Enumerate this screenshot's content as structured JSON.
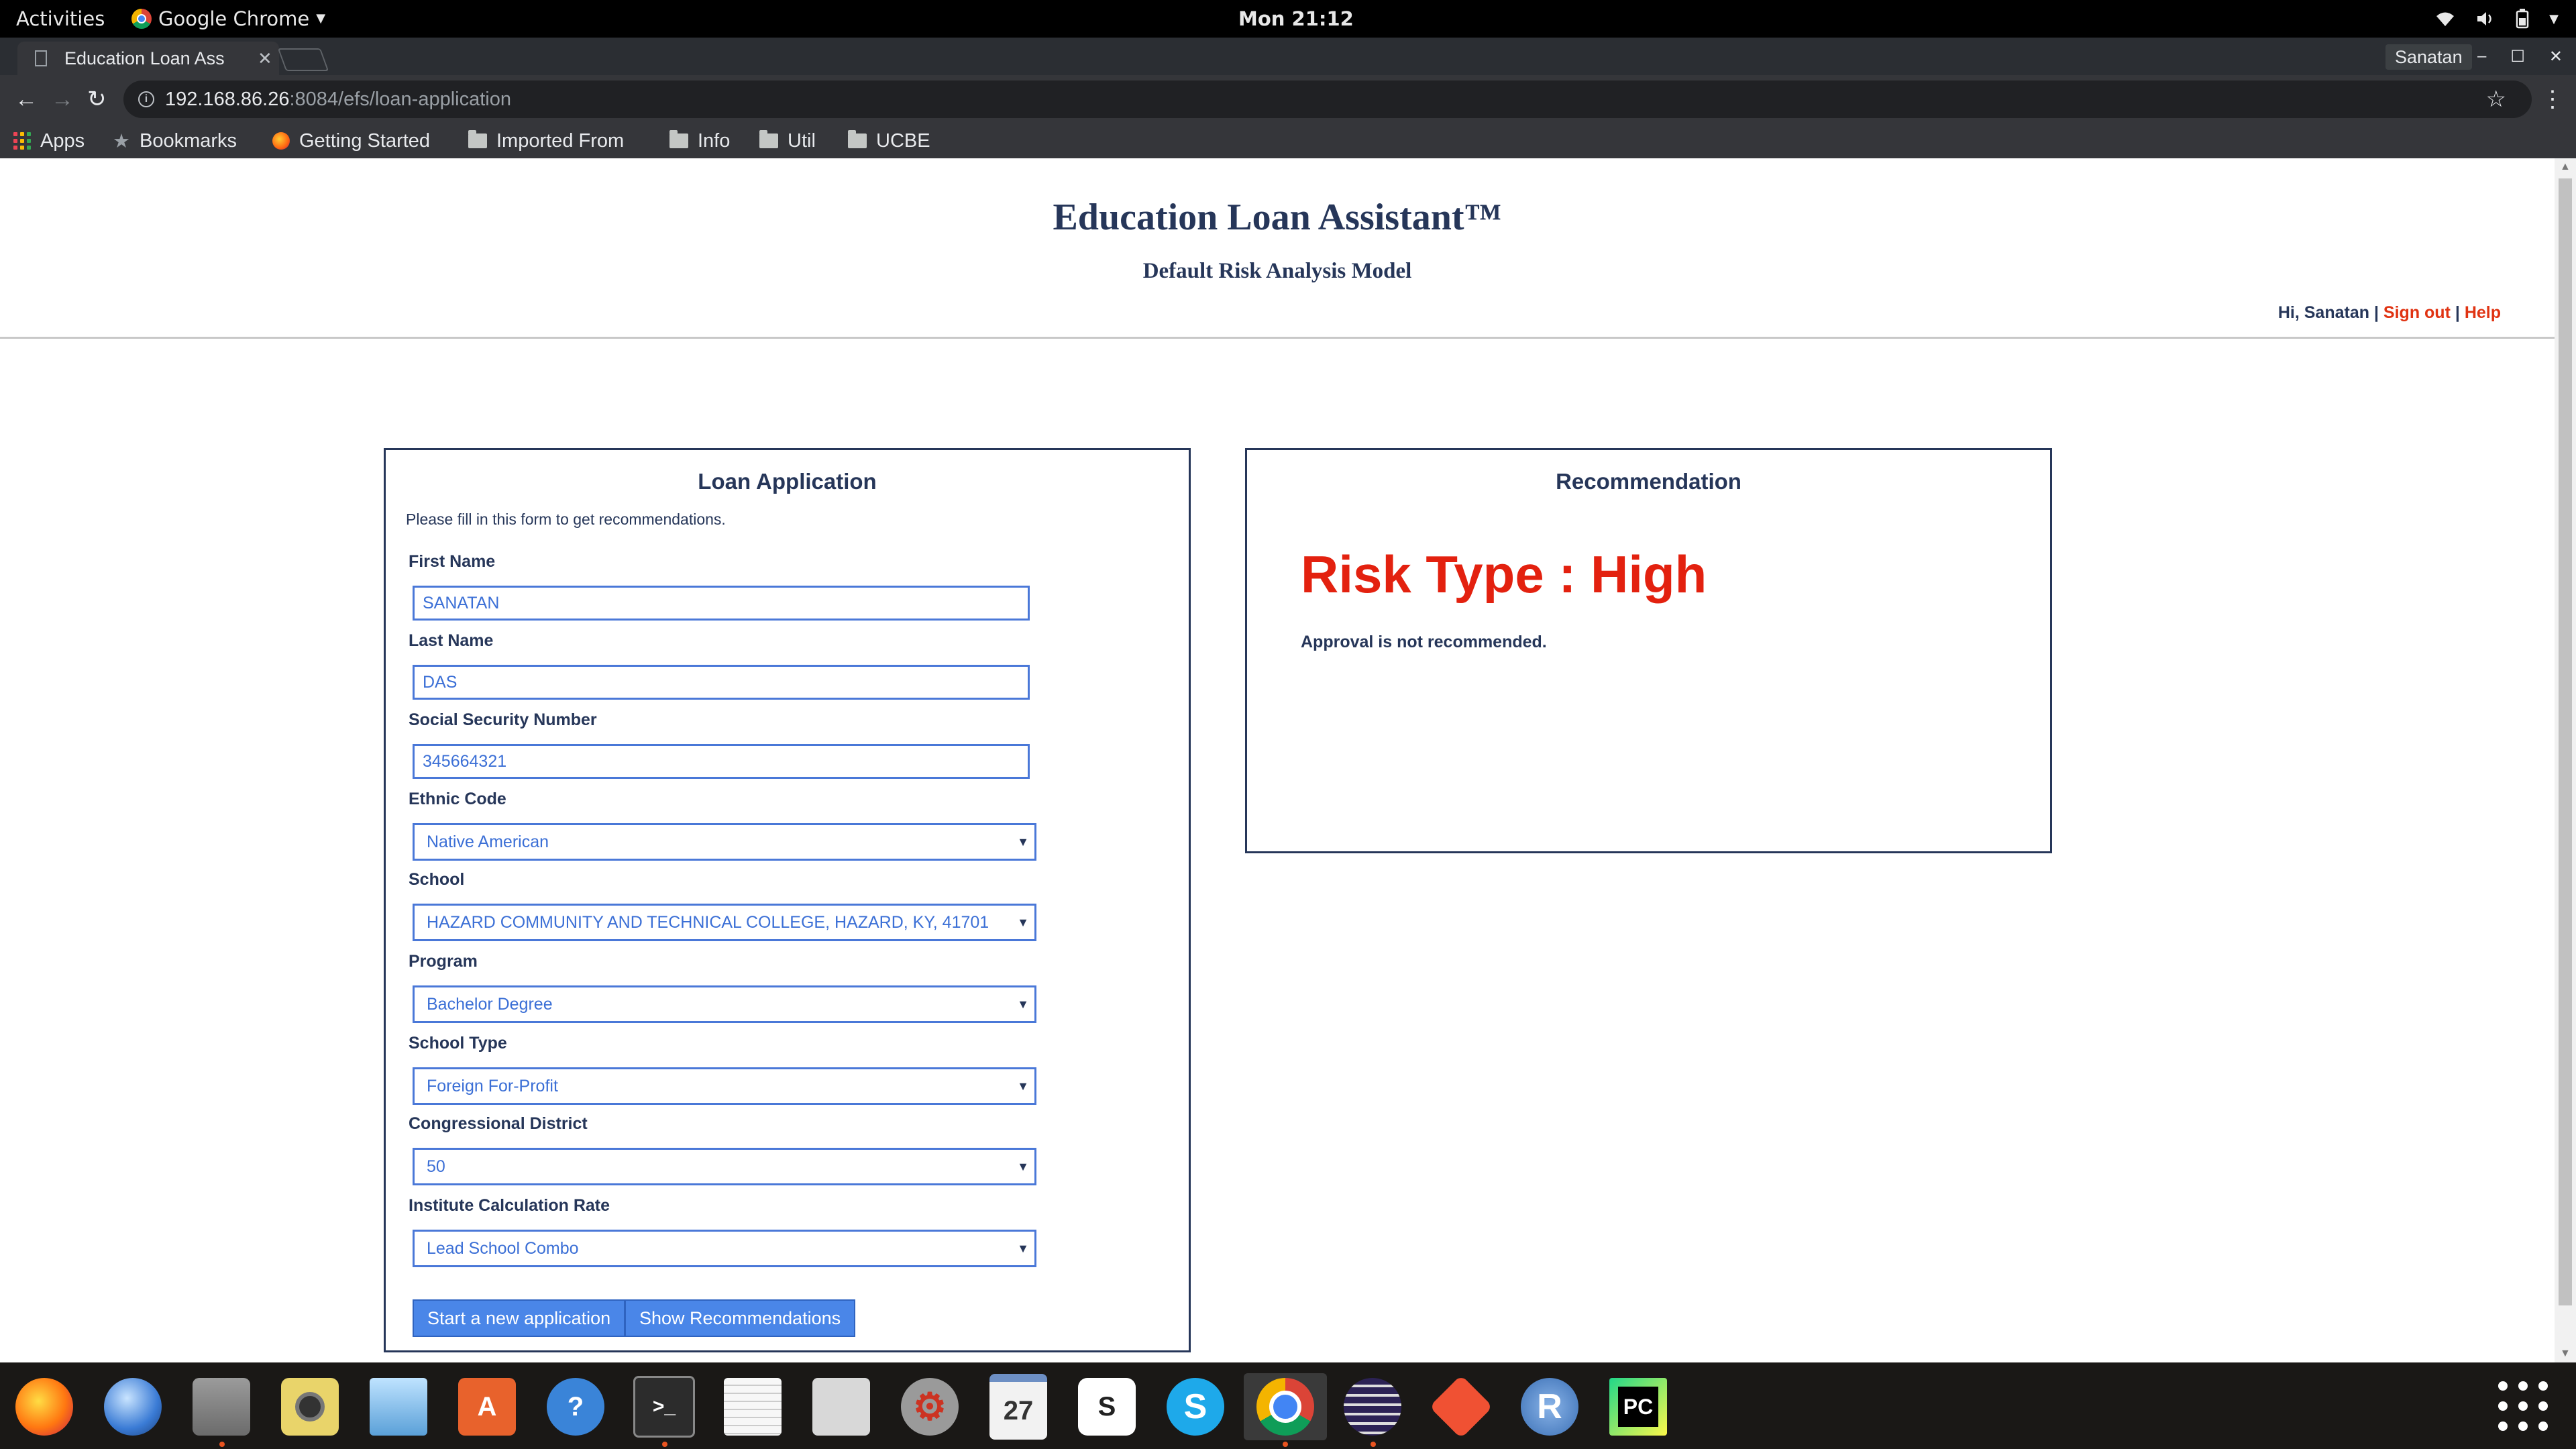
{
  "system_bar": {
    "activities": "Activities",
    "app_name": "Google Chrome",
    "clock": "Mon 21:12"
  },
  "browser": {
    "tab_title": "Education Loan Ass",
    "profile": "Sanatan",
    "url_host": "192.168.86.26",
    "url_path": ":8084/efs/loan-application",
    "bookmarks": {
      "apps": "Apps",
      "bookmarks": "Bookmarks",
      "getting_started": "Getting Started",
      "imported": "Imported From",
      "info": "Info",
      "util": "Util",
      "ucbe": "UCBE"
    }
  },
  "page": {
    "title": "Education Loan Assistant™",
    "subtitle": "Default Risk Analysis Model",
    "greeting": "Hi, Sanatan",
    "separator": "|",
    "sign_out": "Sign out",
    "help": "Help"
  },
  "loan_form": {
    "title": "Loan Application",
    "intro": "Please fill in this form to get recommendations.",
    "first_name": {
      "label": "First Name",
      "value": "SANATAN"
    },
    "last_name": {
      "label": "Last Name",
      "value": "DAS"
    },
    "ssn": {
      "label": "Social Security Number",
      "value": "345664321"
    },
    "ethnic_code": {
      "label": "Ethnic Code",
      "value": "Native American"
    },
    "school": {
      "label": "School",
      "value": "HAZARD COMMUNITY AND TECHNICAL COLLEGE, HAZARD, KY, 41701"
    },
    "program": {
      "label": "Program",
      "value": "Bachelor Degree"
    },
    "school_type": {
      "label": "School Type",
      "value": "Foreign For-Profit"
    },
    "congressional_district": {
      "label": "Congressional District",
      "value": "50"
    },
    "institute_rate": {
      "label": "Institute Calculation Rate",
      "value": "Lead School Combo"
    },
    "new_app_button": "Start a new application",
    "show_rec_button": "Show Recommendations"
  },
  "recommendation": {
    "title": "Recommendation",
    "risk": "Risk Type : High",
    "approval": "Approval is not recommended.",
    "risk_color": "#e3210f"
  },
  "dock": {
    "calendar_day": "27",
    "r_label": "R",
    "pc_label": "PC",
    "slack_label": "S",
    "skype_label": "S"
  },
  "colors": {
    "navy": "#263659",
    "link_red": "#e03312",
    "input_border": "#4a78d8",
    "button_blue": "#4a86e8"
  }
}
